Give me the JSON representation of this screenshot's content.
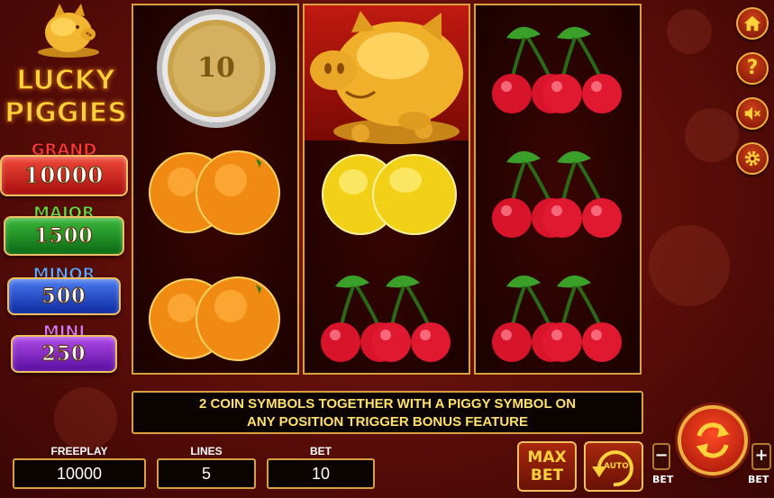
{
  "logo": {
    "line1": "LUCKY",
    "line2": "PIGGIES"
  },
  "jackpots": {
    "grand": {
      "label": "GRAND",
      "value": "10000",
      "color": "#d62020"
    },
    "major": {
      "label": "MAJOR",
      "value": "1500",
      "color": "#1f9a2a"
    },
    "minor": {
      "label": "MINOR",
      "value": "500",
      "color": "#1f4fd6"
    },
    "mini": {
      "label": "MINI",
      "value": "250",
      "color": "#8a24c8"
    }
  },
  "reels": [
    [
      "coin",
      "orange",
      "orange"
    ],
    [
      "piggy",
      "lemon",
      "cherry"
    ],
    [
      "cherry",
      "cherry",
      "cherry"
    ]
  ],
  "coin_value": "10",
  "message": {
    "line1": "2 COIN SYMBOLS TOGETHER WITH A PIGGY SYMBOL ON",
    "line2": "ANY POSITION TRIGGER BONUS FEATURE"
  },
  "fields": {
    "freeplay": {
      "label": "FREEPLAY",
      "value": "10000"
    },
    "lines": {
      "label": "LINES",
      "value": "5"
    },
    "bet": {
      "label": "BET",
      "value": "10"
    }
  },
  "buttons": {
    "max_bet_line1": "MAX",
    "max_bet_line2": "BET",
    "auto": "AUTO",
    "bet_minus": "BET",
    "bet_plus": "BET"
  },
  "side_icons": [
    "home-icon",
    "help-icon",
    "sound-muted-icon",
    "settings-icon"
  ],
  "colors": {
    "gold": "#d9a042",
    "message_text": "#ffe16a",
    "spin_red": "#d02a10"
  }
}
